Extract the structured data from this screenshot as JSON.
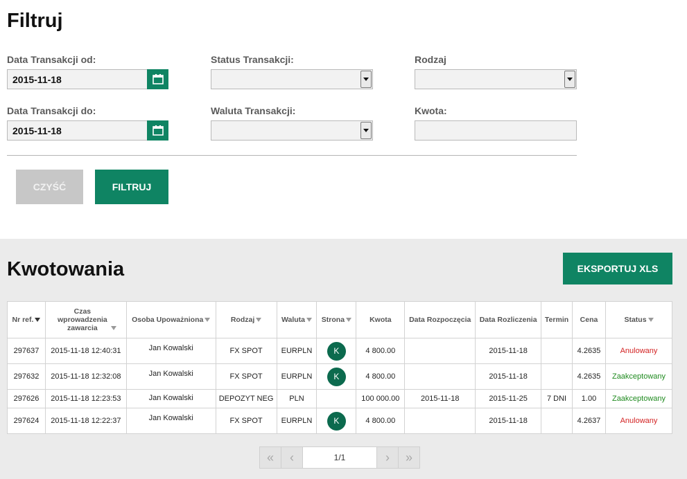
{
  "filter": {
    "title": "Filtruj",
    "date_from_label": "Data Transakcji od:",
    "date_from_value": "2015-11-18",
    "date_to_label": "Data Transakcji do:",
    "date_to_value": "2015-11-18",
    "status_label": "Status Transakcji:",
    "status_value": "",
    "currency_label": "Waluta Transakcji:",
    "currency_value": "",
    "type_label": "Rodzaj",
    "type_value": "",
    "amount_label": "Kwota:",
    "amount_value": "",
    "clear_label": "CZYŚĆ",
    "submit_label": "FILTRUJ"
  },
  "quotes": {
    "title": "Kwotowania",
    "export_label": "EKSPORTUJ XLS",
    "columns": [
      {
        "label": "Nr ref.",
        "sort": "dark"
      },
      {
        "label": "Czas wprowadzenia zawarcia",
        "sort": "outline"
      },
      {
        "label": "Osoba Upoważniona",
        "sort": "outline"
      },
      {
        "label": "Rodzaj",
        "sort": "outline"
      },
      {
        "label": "Waluta",
        "sort": "outline"
      },
      {
        "label": "Strona",
        "sort": "outline"
      },
      {
        "label": "Kwota",
        "sort": ""
      },
      {
        "label": "Data Rozpoczęcia",
        "sort": ""
      },
      {
        "label": "Data Rozliczenia",
        "sort": ""
      },
      {
        "label": "Termin",
        "sort": ""
      },
      {
        "label": "Cena",
        "sort": ""
      },
      {
        "label": "Status",
        "sort": "outline"
      }
    ],
    "rows": [
      {
        "ref": "297637",
        "time": "2015-11-18 12:40:31",
        "person": "Jan Kowalski",
        "type": "FX SPOT",
        "currency": "EURPLN",
        "side": "K",
        "amount": "4 800.00",
        "start": "",
        "settle": "2015-11-18",
        "term": "",
        "price": "4.2635",
        "status": "Anulowany",
        "status_color": "#d32222"
      },
      {
        "ref": "297632",
        "time": "2015-11-18 12:32:08",
        "person": "Jan Kowalski",
        "type": "FX SPOT",
        "currency": "EURPLN",
        "side": "K",
        "amount": "4 800.00",
        "start": "",
        "settle": "2015-11-18",
        "term": "",
        "price": "4.2635",
        "status": "Zaakceptowany",
        "status_color": "#1e8a1e"
      },
      {
        "ref": "297626",
        "time": "2015-11-18 12:23:53",
        "person": "Jan Kowalski",
        "type": "DEPOZYT NEG",
        "currency": "PLN",
        "side": "",
        "amount": "100 000.00",
        "start": "2015-11-18",
        "settle": "2015-11-25",
        "term": "7 DNI",
        "price": "1.00",
        "status": "Zaakceptowany",
        "status_color": "#1e8a1e"
      },
      {
        "ref": "297624",
        "time": "2015-11-18 12:22:37",
        "person": "Jan Kowalski",
        "type": "FX SPOT",
        "currency": "EURPLN",
        "side": "K",
        "amount": "4 800.00",
        "start": "",
        "settle": "2015-11-18",
        "term": "",
        "price": "4.2637",
        "status": "Anulowany",
        "status_color": "#d32222"
      }
    ],
    "pagination": {
      "page_text": "1/1",
      "first_icon": "«",
      "prev_icon": "‹",
      "next_icon": "›",
      "last_icon": "»"
    }
  },
  "colors": {
    "accent": "#0f8463",
    "cancelled": "#d32222",
    "accepted": "#1e8a1e"
  },
  "icons": {
    "date_picker": "calendar-icon",
    "dropdown": "caret-down-icon",
    "sort": "sort-down-icon"
  }
}
